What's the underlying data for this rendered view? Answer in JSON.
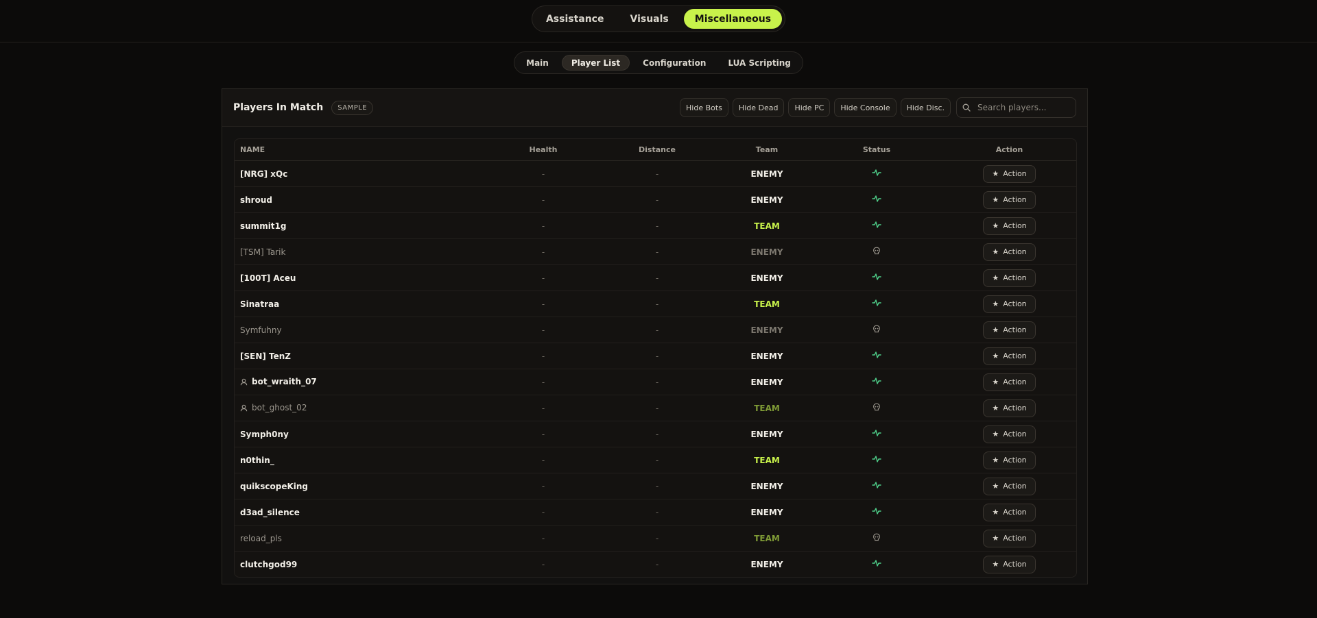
{
  "top_tabs": [
    {
      "label": "Assistance",
      "active": false
    },
    {
      "label": "Visuals",
      "active": false
    },
    {
      "label": "Miscellaneous",
      "active": true
    }
  ],
  "sub_tabs": [
    {
      "label": "Main",
      "active": false
    },
    {
      "label": "Player List",
      "active": true
    },
    {
      "label": "Configuration",
      "active": false
    },
    {
      "label": "LUA Scripting",
      "active": false
    }
  ],
  "panel": {
    "title": "Players In Match",
    "badge": "SAMPLE",
    "filters": [
      "Hide Bots",
      "Hide Dead",
      "Hide PC",
      "Hide Console",
      "Hide Disc."
    ],
    "search_placeholder": "Search players..."
  },
  "table": {
    "columns": [
      "NAME",
      "Health",
      "Distance",
      "Team",
      "Status",
      "Action"
    ],
    "action_label": "Action",
    "empty_value": "-",
    "rows": [
      {
        "name": "[NRG] xQc",
        "team": "ENEMY",
        "status": "alive-icon",
        "bot": false,
        "dim": false
      },
      {
        "name": "shroud",
        "team": "ENEMY",
        "status": "alive-icon",
        "bot": false,
        "dim": false
      },
      {
        "name": "summit1g",
        "team": "TEAM",
        "status": "alive-icon",
        "bot": false,
        "dim": false
      },
      {
        "name": "[TSM] Tarik",
        "team": "ENEMY",
        "status": "dead-icon",
        "bot": false,
        "dim": true
      },
      {
        "name": "[100T] Aceu",
        "team": "ENEMY",
        "status": "alive-icon",
        "bot": false,
        "dim": false
      },
      {
        "name": "Sinatraa",
        "team": "TEAM",
        "status": "alive-icon",
        "bot": false,
        "dim": false
      },
      {
        "name": "Symfuhny",
        "team": "ENEMY",
        "status": "dead-icon",
        "bot": false,
        "dim": true
      },
      {
        "name": "[SEN] TenZ",
        "team": "ENEMY",
        "status": "alive-icon",
        "bot": false,
        "dim": false
      },
      {
        "name": "bot_wraith_07",
        "team": "ENEMY",
        "status": "alive-icon",
        "bot": true,
        "dim": false
      },
      {
        "name": "bot_ghost_02",
        "team": "TEAM",
        "status": "dead-icon",
        "bot": true,
        "dim": true
      },
      {
        "name": "Symph0ny",
        "team": "ENEMY",
        "status": "alive-icon",
        "bot": false,
        "dim": false
      },
      {
        "name": "n0thin_",
        "team": "TEAM",
        "status": "alive-icon",
        "bot": false,
        "dim": false
      },
      {
        "name": "quikscopeKing",
        "team": "ENEMY",
        "status": "alive-icon",
        "bot": false,
        "dim": false
      },
      {
        "name": "d3ad_silence",
        "team": "ENEMY",
        "status": "alive-icon",
        "bot": false,
        "dim": false
      },
      {
        "name": "reload_pls",
        "team": "TEAM",
        "status": "dead-icon",
        "bot": false,
        "dim": true
      },
      {
        "name": "clutchgod99",
        "team": "ENEMY",
        "status": "alive-icon",
        "bot": false,
        "dim": false
      }
    ]
  },
  "colors": {
    "accent": "#c8f24b",
    "alive": "#4fd18b",
    "dead": "#9c978e"
  }
}
